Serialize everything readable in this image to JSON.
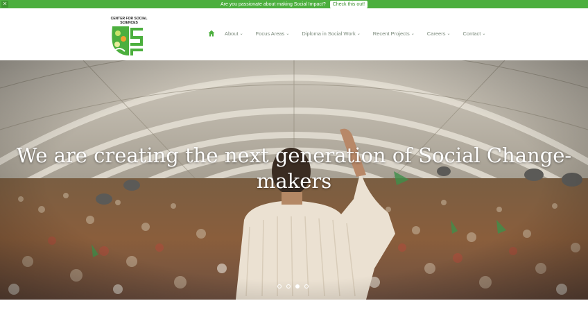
{
  "topbar": {
    "close_icon": "close-icon",
    "message": "Are you passionate about making Social Impact?",
    "cta_label": "Check this out!"
  },
  "logo": {
    "text": "CENTER FOR SOCIAL SCIENCES"
  },
  "nav": {
    "home_icon": "home-icon",
    "items": [
      {
        "label": "About"
      },
      {
        "label": "Focus Areas"
      },
      {
        "label": "Diploma in Social Work"
      },
      {
        "label": "Recent Projects"
      },
      {
        "label": "Careers"
      },
      {
        "label": "Contact"
      }
    ]
  },
  "hero": {
    "headline": "We are creating the next generation of Social Change-makers",
    "slides_total": 4,
    "active_slide": 3
  },
  "colors": {
    "brand_green": "#4caf3e",
    "nav_text": "#7b8a7b"
  }
}
